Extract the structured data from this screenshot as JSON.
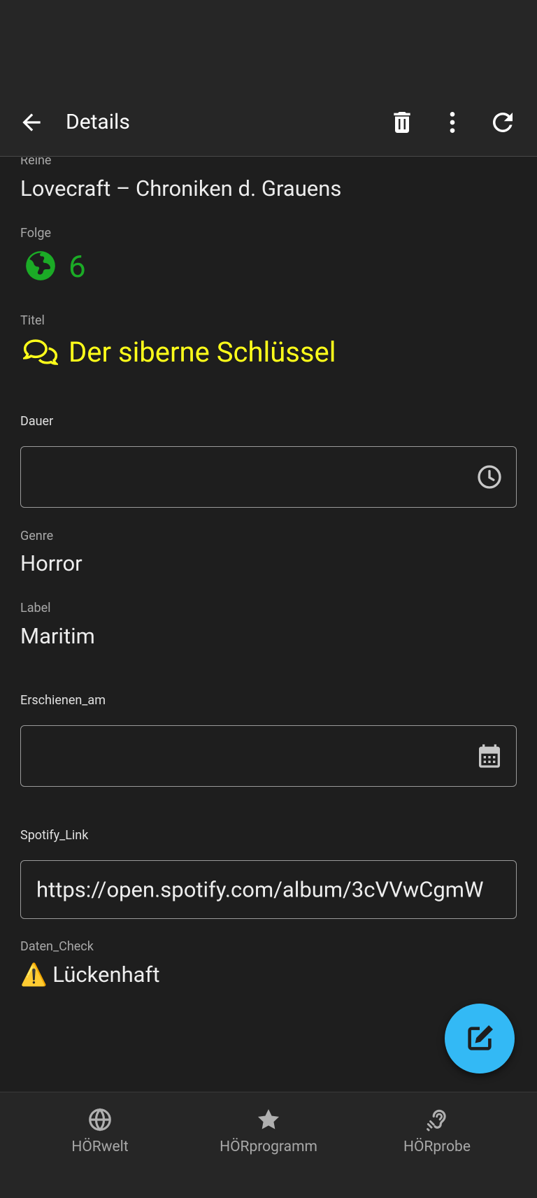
{
  "appbar": {
    "title": "Details"
  },
  "fields": {
    "reihe": {
      "label": "Reihe",
      "value": "Lovecraft – Chroniken d. Grauens"
    },
    "folge": {
      "label": "Folge",
      "value": "6",
      "color": "#1bab26"
    },
    "titel": {
      "label": "Titel",
      "value": "Der siberne Schlüssel",
      "color": "#ffff1a"
    },
    "dauer": {
      "label": "Dauer",
      "value": ""
    },
    "genre": {
      "label": "Genre",
      "value": "Horror"
    },
    "label": {
      "label": "Label",
      "value": "Maritim"
    },
    "erschienen": {
      "label": "Erschienen_am",
      "value": ""
    },
    "spotify": {
      "label": "Spotify_Link",
      "value": "https://open.spotify.com/album/3cVVwCgmW"
    },
    "daten_check": {
      "label": "Daten_Check",
      "value": "⚠️ Lückenhaft"
    }
  },
  "bottom_nav": [
    {
      "label": "HÖRwelt",
      "icon": "globe-icon"
    },
    {
      "label": "HÖRprogramm",
      "icon": "star-icon"
    },
    {
      "label": "HÖRprobe",
      "icon": "hearing-icon"
    }
  ],
  "colors": {
    "accent": "#33b9f5",
    "background": "#1e1e1e",
    "appbar": "#262626"
  }
}
